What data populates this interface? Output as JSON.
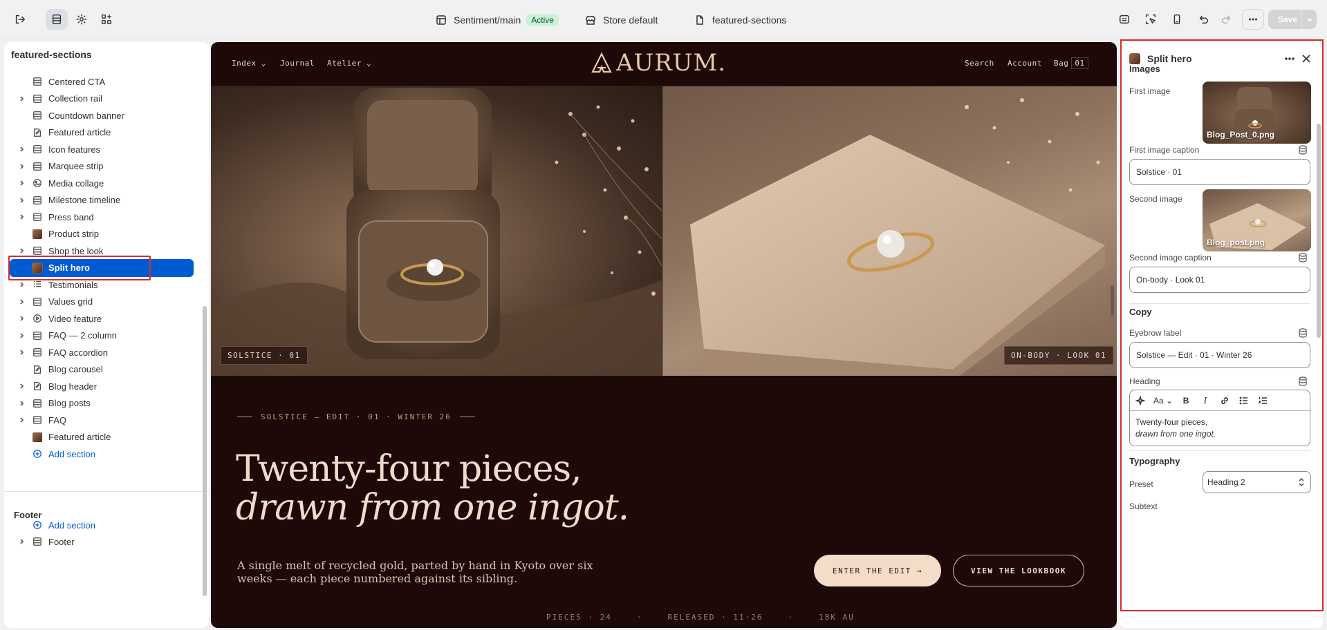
{
  "topbar": {
    "theme_name": "Sentiment/main",
    "status_badge": "Active",
    "store": "Store default",
    "template": "featured-sections",
    "save_label": "Save"
  },
  "sidebar": {
    "title": "featured-sections",
    "items": [
      {
        "label": "Centered CTA",
        "icon": "section-icon",
        "chevron": false
      },
      {
        "label": "Collection rail",
        "icon": "section-icon",
        "chevron": true
      },
      {
        "label": "Countdown banner",
        "icon": "section-icon",
        "chevron": false
      },
      {
        "label": "Featured article",
        "icon": "article-icon",
        "chevron": false
      },
      {
        "label": "Icon features",
        "icon": "section-icon",
        "chevron": true
      },
      {
        "label": "Marquee strip",
        "icon": "section-icon",
        "chevron": true
      },
      {
        "label": "Media collage",
        "icon": "media-icon",
        "chevron": true
      },
      {
        "label": "Milestone timeline",
        "icon": "section-icon",
        "chevron": true
      },
      {
        "label": "Press band",
        "icon": "section-icon",
        "chevron": true
      },
      {
        "label": "Product strip",
        "icon": "image-thumb-icon",
        "chevron": false
      },
      {
        "label": "Shop the look",
        "icon": "section-icon",
        "chevron": true
      },
      {
        "label": "Split hero",
        "icon": "image-thumb-icon",
        "chevron": false,
        "selected": true
      },
      {
        "label": "Testimonials",
        "icon": "list-icon",
        "chevron": true
      },
      {
        "label": "Values grid",
        "icon": "section-icon",
        "chevron": true
      },
      {
        "label": "Video feature",
        "icon": "play-icon",
        "chevron": true
      },
      {
        "label": "FAQ — 2 column",
        "icon": "section-icon",
        "chevron": true
      },
      {
        "label": "FAQ accordion",
        "icon": "section-icon",
        "chevron": true
      },
      {
        "label": "Blog carousel",
        "icon": "article-icon",
        "chevron": false
      },
      {
        "label": "Blog header",
        "icon": "article-icon",
        "chevron": true
      },
      {
        "label": "Blog posts",
        "icon": "section-icon",
        "chevron": true
      },
      {
        "label": "FAQ",
        "icon": "section-icon",
        "chevron": true
      },
      {
        "label": "Featured article",
        "icon": "image-thumb-icon",
        "chevron": false
      },
      {
        "label": "Add section",
        "icon": "plus-circle-icon",
        "chevron": false,
        "add": true
      }
    ],
    "footer_group_title": "Footer",
    "footer_add_label": "Add section",
    "footer_item_label": "Footer"
  },
  "preview": {
    "nav_left": [
      "Index",
      "Journal",
      "Atelier"
    ],
    "logo_text": "AURUM.",
    "nav_right": [
      "Search",
      "Account",
      "Bag"
    ],
    "bag_count": "01",
    "caption_left": "SOLSTICE · 01",
    "caption_right": "ON-BODY · LOOK 01",
    "eyebrow": "SOLSTICE — EDIT · 01 · WINTER 26",
    "heading_line1": "Twenty-four pieces,",
    "heading_line2": "drawn from one ingot.",
    "subtext": "A single melt of recycled gold, parted by hand in Kyoto over six weeks — each piece numbered against its sibling.",
    "primary_button": "ENTER THE EDIT →",
    "secondary_button": "VIEW THE LOOKBOOK",
    "stats": [
      "PIECES · 24",
      "RELEASED · 11·26",
      "18K AU"
    ]
  },
  "settings": {
    "title": "Split hero",
    "images_section": "Images",
    "first_image_label": "First image",
    "first_image_file": "Blog_Post_0.png",
    "first_caption_label": "First image caption",
    "first_caption_value": "Solstice · 01",
    "second_image_label": "Second image",
    "second_image_file": "Blog_post.png",
    "second_caption_label": "Second image caption",
    "second_caption_value": "On-body · Look 01",
    "copy_section": "Copy",
    "eyebrow_label": "Eyebrow label",
    "eyebrow_value": "Solstice — Edit · 01 · Winter 26",
    "heading_label": "Heading",
    "heading_line1": "Twenty-four pieces,",
    "heading_line2": "drawn from one ingot.",
    "typography_section": "Typography",
    "preset_label": "Preset",
    "preset_value": "Heading 2",
    "subtext_label": "Subtext"
  },
  "colors": {
    "selection_blue": "#005bd3",
    "highlight_red": "#d72c2c",
    "preview_bg": "#1c0908",
    "accent_gold": "#e8c9a8"
  }
}
